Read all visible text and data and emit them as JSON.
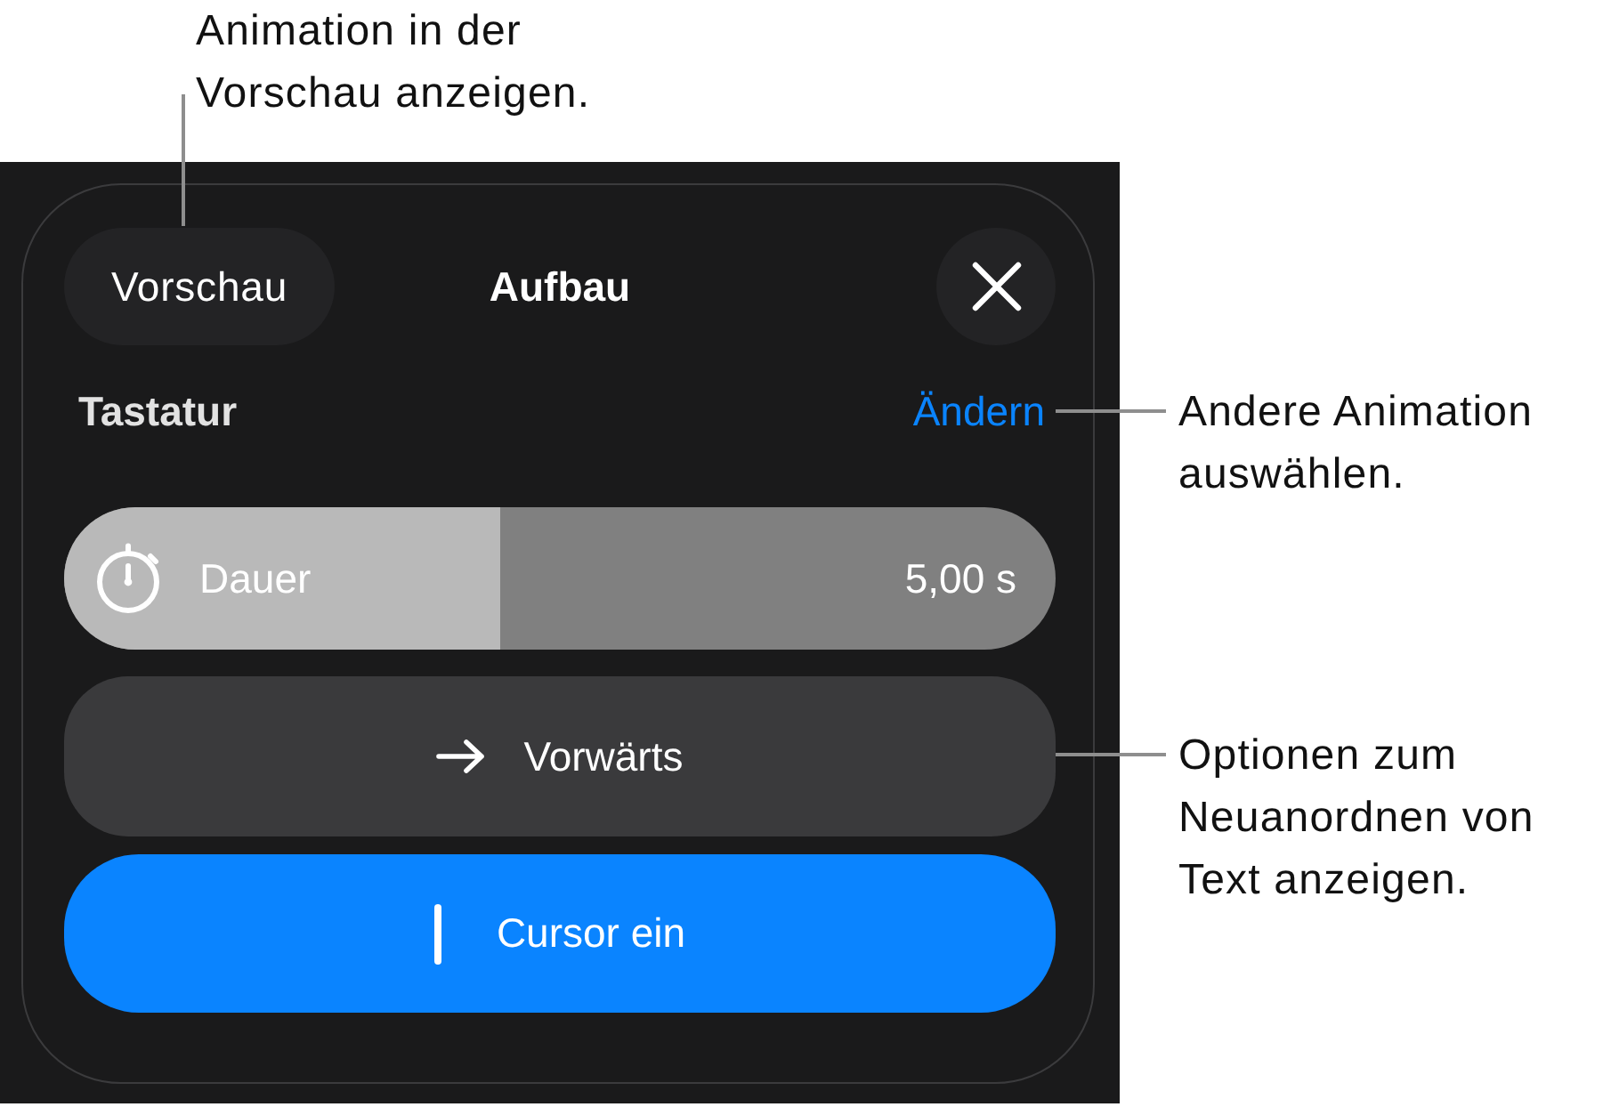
{
  "callouts": [
    {
      "text": "Animation in der\nVorschau anzeigen."
    },
    {
      "text": "Andere Animation\nauswählen."
    },
    {
      "text": "Optionen zum\nNeuanordnen von\nText anzeigen."
    }
  ],
  "header": {
    "preview_button": "Vorschau",
    "title": "Aufbau"
  },
  "animation": {
    "name": "Tastatur",
    "change_link": "Ändern"
  },
  "duration": {
    "label": "Dauer",
    "reading": "5,00 s",
    "level": 0.44
  },
  "direction_button": {
    "label": "Vorwärts"
  },
  "cursor_button": {
    "label": "Cursor ein",
    "on": true
  }
}
